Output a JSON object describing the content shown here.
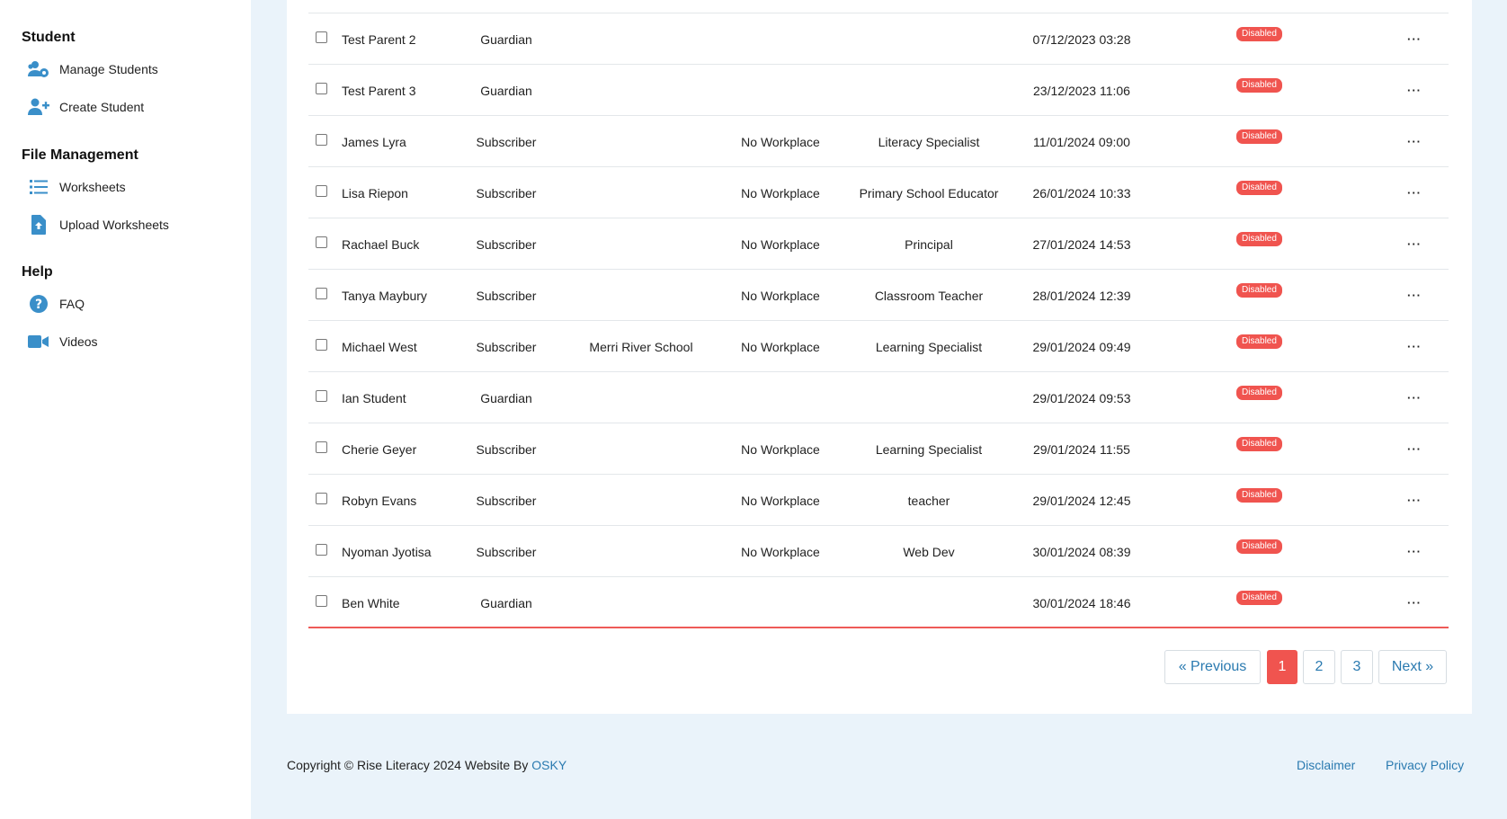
{
  "sidebar": {
    "sections": [
      {
        "title": "Student",
        "items": [
          {
            "label": "Manage Students",
            "icon": "users-gear-icon"
          },
          {
            "label": "Create Student",
            "icon": "user-plus-icon"
          }
        ]
      },
      {
        "title": "File Management",
        "items": [
          {
            "label": "Worksheets",
            "icon": "list-icon"
          },
          {
            "label": "Upload Worksheets",
            "icon": "file-upload-icon"
          }
        ]
      },
      {
        "title": "Help",
        "items": [
          {
            "label": "FAQ",
            "icon": "question-circle-icon"
          },
          {
            "label": "Videos",
            "icon": "video-camera-icon"
          }
        ]
      }
    ]
  },
  "table": {
    "rows": [
      {
        "name": "Test Parent 2",
        "role": "Guardian",
        "school": "",
        "workplace": "",
        "position": "",
        "date": "07/12/2023 03:28",
        "status": "Disabled"
      },
      {
        "name": "Test Parent 3",
        "role": "Guardian",
        "school": "",
        "workplace": "",
        "position": "",
        "date": "23/12/2023 11:06",
        "status": "Disabled"
      },
      {
        "name": "James Lyra",
        "role": "Subscriber",
        "school": "",
        "workplace": "No Workplace",
        "position": "Literacy Specialist",
        "date": "11/01/2024 09:00",
        "status": "Disabled"
      },
      {
        "name": "Lisa Riepon",
        "role": "Subscriber",
        "school": "",
        "workplace": "No Workplace",
        "position": "Primary School Educator",
        "date": "26/01/2024 10:33",
        "status": "Disabled"
      },
      {
        "name": "Rachael Buck",
        "role": "Subscriber",
        "school": "",
        "workplace": "No Workplace",
        "position": "Principal",
        "date": "27/01/2024 14:53",
        "status": "Disabled"
      },
      {
        "name": "Tanya Maybury",
        "role": "Subscriber",
        "school": "",
        "workplace": "No Workplace",
        "position": "Classroom Teacher",
        "date": "28/01/2024 12:39",
        "status": "Disabled"
      },
      {
        "name": "Michael West",
        "role": "Subscriber",
        "school": "Merri River School",
        "workplace": "No Workplace",
        "position": "Learning Specialist",
        "date": "29/01/2024 09:49",
        "status": "Disabled"
      },
      {
        "name": "Ian Student",
        "role": "Guardian",
        "school": "",
        "workplace": "",
        "position": "",
        "date": "29/01/2024 09:53",
        "status": "Disabled"
      },
      {
        "name": "Cherie Geyer",
        "role": "Subscriber",
        "school": "",
        "workplace": "No Workplace",
        "position": "Learning Specialist",
        "date": "29/01/2024 11:55",
        "status": "Disabled"
      },
      {
        "name": "Robyn Evans",
        "role": "Subscriber",
        "school": "",
        "workplace": "No Workplace",
        "position": "teacher",
        "date": "29/01/2024 12:45",
        "status": "Disabled"
      },
      {
        "name": "Nyoman Jyotisa",
        "role": "Subscriber",
        "school": "",
        "workplace": "No Workplace",
        "position": "Web Dev",
        "date": "30/01/2024 08:39",
        "status": "Disabled"
      },
      {
        "name": "Ben White",
        "role": "Guardian",
        "school": "",
        "workplace": "",
        "position": "",
        "date": "30/01/2024 18:46",
        "status": "Disabled"
      }
    ],
    "menu_glyph": "···"
  },
  "pagination": {
    "previous": "« Previous",
    "pages": [
      "1",
      "2",
      "3"
    ],
    "current": "1",
    "next": "Next »"
  },
  "footer": {
    "copyright": "Copyright © Rise Literacy 2024 Website By ",
    "brand_link": "OSKY",
    "links": [
      "Disclaimer",
      "Privacy Policy"
    ]
  },
  "colors": {
    "accent": "#2a7ab0",
    "danger": "#f0544f",
    "icon_blue": "#3a8fc9",
    "page_bg": "#eaf3fa"
  }
}
